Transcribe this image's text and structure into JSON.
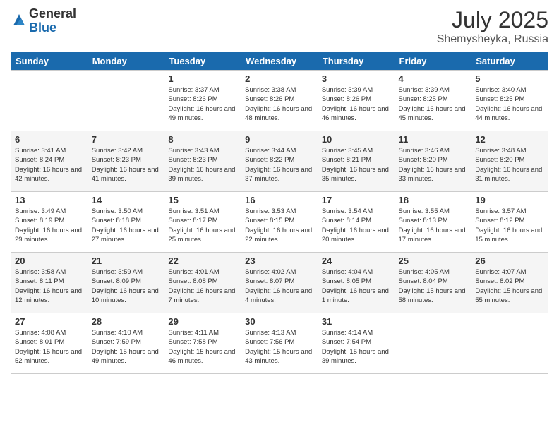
{
  "logo": {
    "general": "General",
    "blue": "Blue"
  },
  "title": {
    "month_year": "July 2025",
    "location": "Shemysheyka, Russia"
  },
  "weekdays": [
    "Sunday",
    "Monday",
    "Tuesday",
    "Wednesday",
    "Thursday",
    "Friday",
    "Saturday"
  ],
  "weeks": [
    [
      null,
      null,
      {
        "day": 1,
        "sunrise": "3:37 AM",
        "sunset": "8:26 PM",
        "daylight": "16 hours and 49 minutes."
      },
      {
        "day": 2,
        "sunrise": "3:38 AM",
        "sunset": "8:26 PM",
        "daylight": "16 hours and 48 minutes."
      },
      {
        "day": 3,
        "sunrise": "3:39 AM",
        "sunset": "8:26 PM",
        "daylight": "16 hours and 46 minutes."
      },
      {
        "day": 4,
        "sunrise": "3:39 AM",
        "sunset": "8:25 PM",
        "daylight": "16 hours and 45 minutes."
      },
      {
        "day": 5,
        "sunrise": "3:40 AM",
        "sunset": "8:25 PM",
        "daylight": "16 hours and 44 minutes."
      }
    ],
    [
      {
        "day": 6,
        "sunrise": "3:41 AM",
        "sunset": "8:24 PM",
        "daylight": "16 hours and 42 minutes."
      },
      {
        "day": 7,
        "sunrise": "3:42 AM",
        "sunset": "8:23 PM",
        "daylight": "16 hours and 41 minutes."
      },
      {
        "day": 8,
        "sunrise": "3:43 AM",
        "sunset": "8:23 PM",
        "daylight": "16 hours and 39 minutes."
      },
      {
        "day": 9,
        "sunrise": "3:44 AM",
        "sunset": "8:22 PM",
        "daylight": "16 hours and 37 minutes."
      },
      {
        "day": 10,
        "sunrise": "3:45 AM",
        "sunset": "8:21 PM",
        "daylight": "16 hours and 35 minutes."
      },
      {
        "day": 11,
        "sunrise": "3:46 AM",
        "sunset": "8:20 PM",
        "daylight": "16 hours and 33 minutes."
      },
      {
        "day": 12,
        "sunrise": "3:48 AM",
        "sunset": "8:20 PM",
        "daylight": "16 hours and 31 minutes."
      }
    ],
    [
      {
        "day": 13,
        "sunrise": "3:49 AM",
        "sunset": "8:19 PM",
        "daylight": "16 hours and 29 minutes."
      },
      {
        "day": 14,
        "sunrise": "3:50 AM",
        "sunset": "8:18 PM",
        "daylight": "16 hours and 27 minutes."
      },
      {
        "day": 15,
        "sunrise": "3:51 AM",
        "sunset": "8:17 PM",
        "daylight": "16 hours and 25 minutes."
      },
      {
        "day": 16,
        "sunrise": "3:53 AM",
        "sunset": "8:15 PM",
        "daylight": "16 hours and 22 minutes."
      },
      {
        "day": 17,
        "sunrise": "3:54 AM",
        "sunset": "8:14 PM",
        "daylight": "16 hours and 20 minutes."
      },
      {
        "day": 18,
        "sunrise": "3:55 AM",
        "sunset": "8:13 PM",
        "daylight": "16 hours and 17 minutes."
      },
      {
        "day": 19,
        "sunrise": "3:57 AM",
        "sunset": "8:12 PM",
        "daylight": "16 hours and 15 minutes."
      }
    ],
    [
      {
        "day": 20,
        "sunrise": "3:58 AM",
        "sunset": "8:11 PM",
        "daylight": "16 hours and 12 minutes."
      },
      {
        "day": 21,
        "sunrise": "3:59 AM",
        "sunset": "8:09 PM",
        "daylight": "16 hours and 10 minutes."
      },
      {
        "day": 22,
        "sunrise": "4:01 AM",
        "sunset": "8:08 PM",
        "daylight": "16 hours and 7 minutes."
      },
      {
        "day": 23,
        "sunrise": "4:02 AM",
        "sunset": "8:07 PM",
        "daylight": "16 hours and 4 minutes."
      },
      {
        "day": 24,
        "sunrise": "4:04 AM",
        "sunset": "8:05 PM",
        "daylight": "16 hours and 1 minute."
      },
      {
        "day": 25,
        "sunrise": "4:05 AM",
        "sunset": "8:04 PM",
        "daylight": "15 hours and 58 minutes."
      },
      {
        "day": 26,
        "sunrise": "4:07 AM",
        "sunset": "8:02 PM",
        "daylight": "15 hours and 55 minutes."
      }
    ],
    [
      {
        "day": 27,
        "sunrise": "4:08 AM",
        "sunset": "8:01 PM",
        "daylight": "15 hours and 52 minutes."
      },
      {
        "day": 28,
        "sunrise": "4:10 AM",
        "sunset": "7:59 PM",
        "daylight": "15 hours and 49 minutes."
      },
      {
        "day": 29,
        "sunrise": "4:11 AM",
        "sunset": "7:58 PM",
        "daylight": "15 hours and 46 minutes."
      },
      {
        "day": 30,
        "sunrise": "4:13 AM",
        "sunset": "7:56 PM",
        "daylight": "15 hours and 43 minutes."
      },
      {
        "day": 31,
        "sunrise": "4:14 AM",
        "sunset": "7:54 PM",
        "daylight": "15 hours and 39 minutes."
      },
      null,
      null
    ]
  ]
}
